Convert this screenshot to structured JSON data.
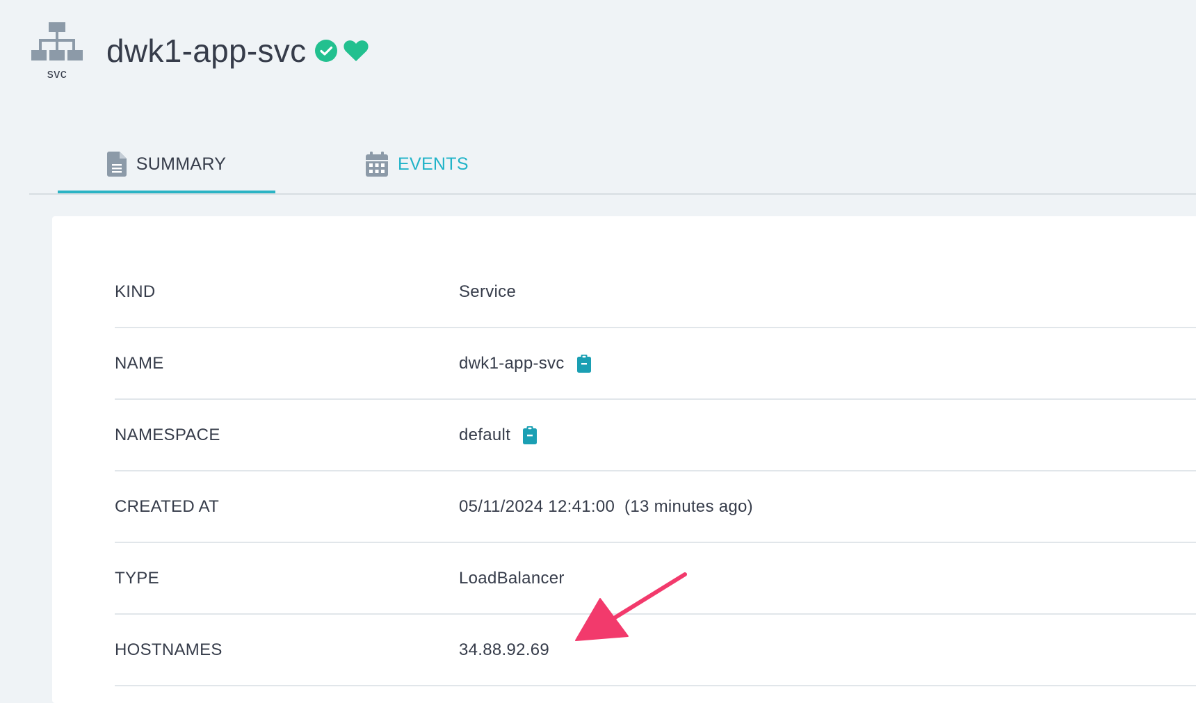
{
  "header": {
    "kind_label": "svc",
    "title": "dwk1-app-svc",
    "kind_icon": "sitemap-icon",
    "status_icon": "check-circle-icon",
    "health_icon": "heart-icon"
  },
  "tabs": [
    {
      "label": "SUMMARY",
      "icon": "file-text-icon",
      "active": true
    },
    {
      "label": "EVENTS",
      "icon": "calendar-icon",
      "active": false
    }
  ],
  "summary": {
    "rows": [
      {
        "key": "KIND",
        "value": "Service"
      },
      {
        "key": "NAME",
        "value": "dwk1-app-svc",
        "copy_icon": "clipboard-icon"
      },
      {
        "key": "NAMESPACE",
        "value": "default",
        "copy_icon": "clipboard-icon"
      },
      {
        "key": "CREATED AT",
        "value": "05/11/2024 12:41:00  (13 minutes ago)"
      },
      {
        "key": "TYPE",
        "value": "LoadBalancer"
      },
      {
        "key": "HOSTNAMES",
        "value": "34.88.92.69"
      }
    ]
  },
  "colors": {
    "accent": "#2ab3c4",
    "status_green": "#22c08f",
    "annotation_arrow": "#f23a6c",
    "icon_gray": "#8c9aa8"
  }
}
